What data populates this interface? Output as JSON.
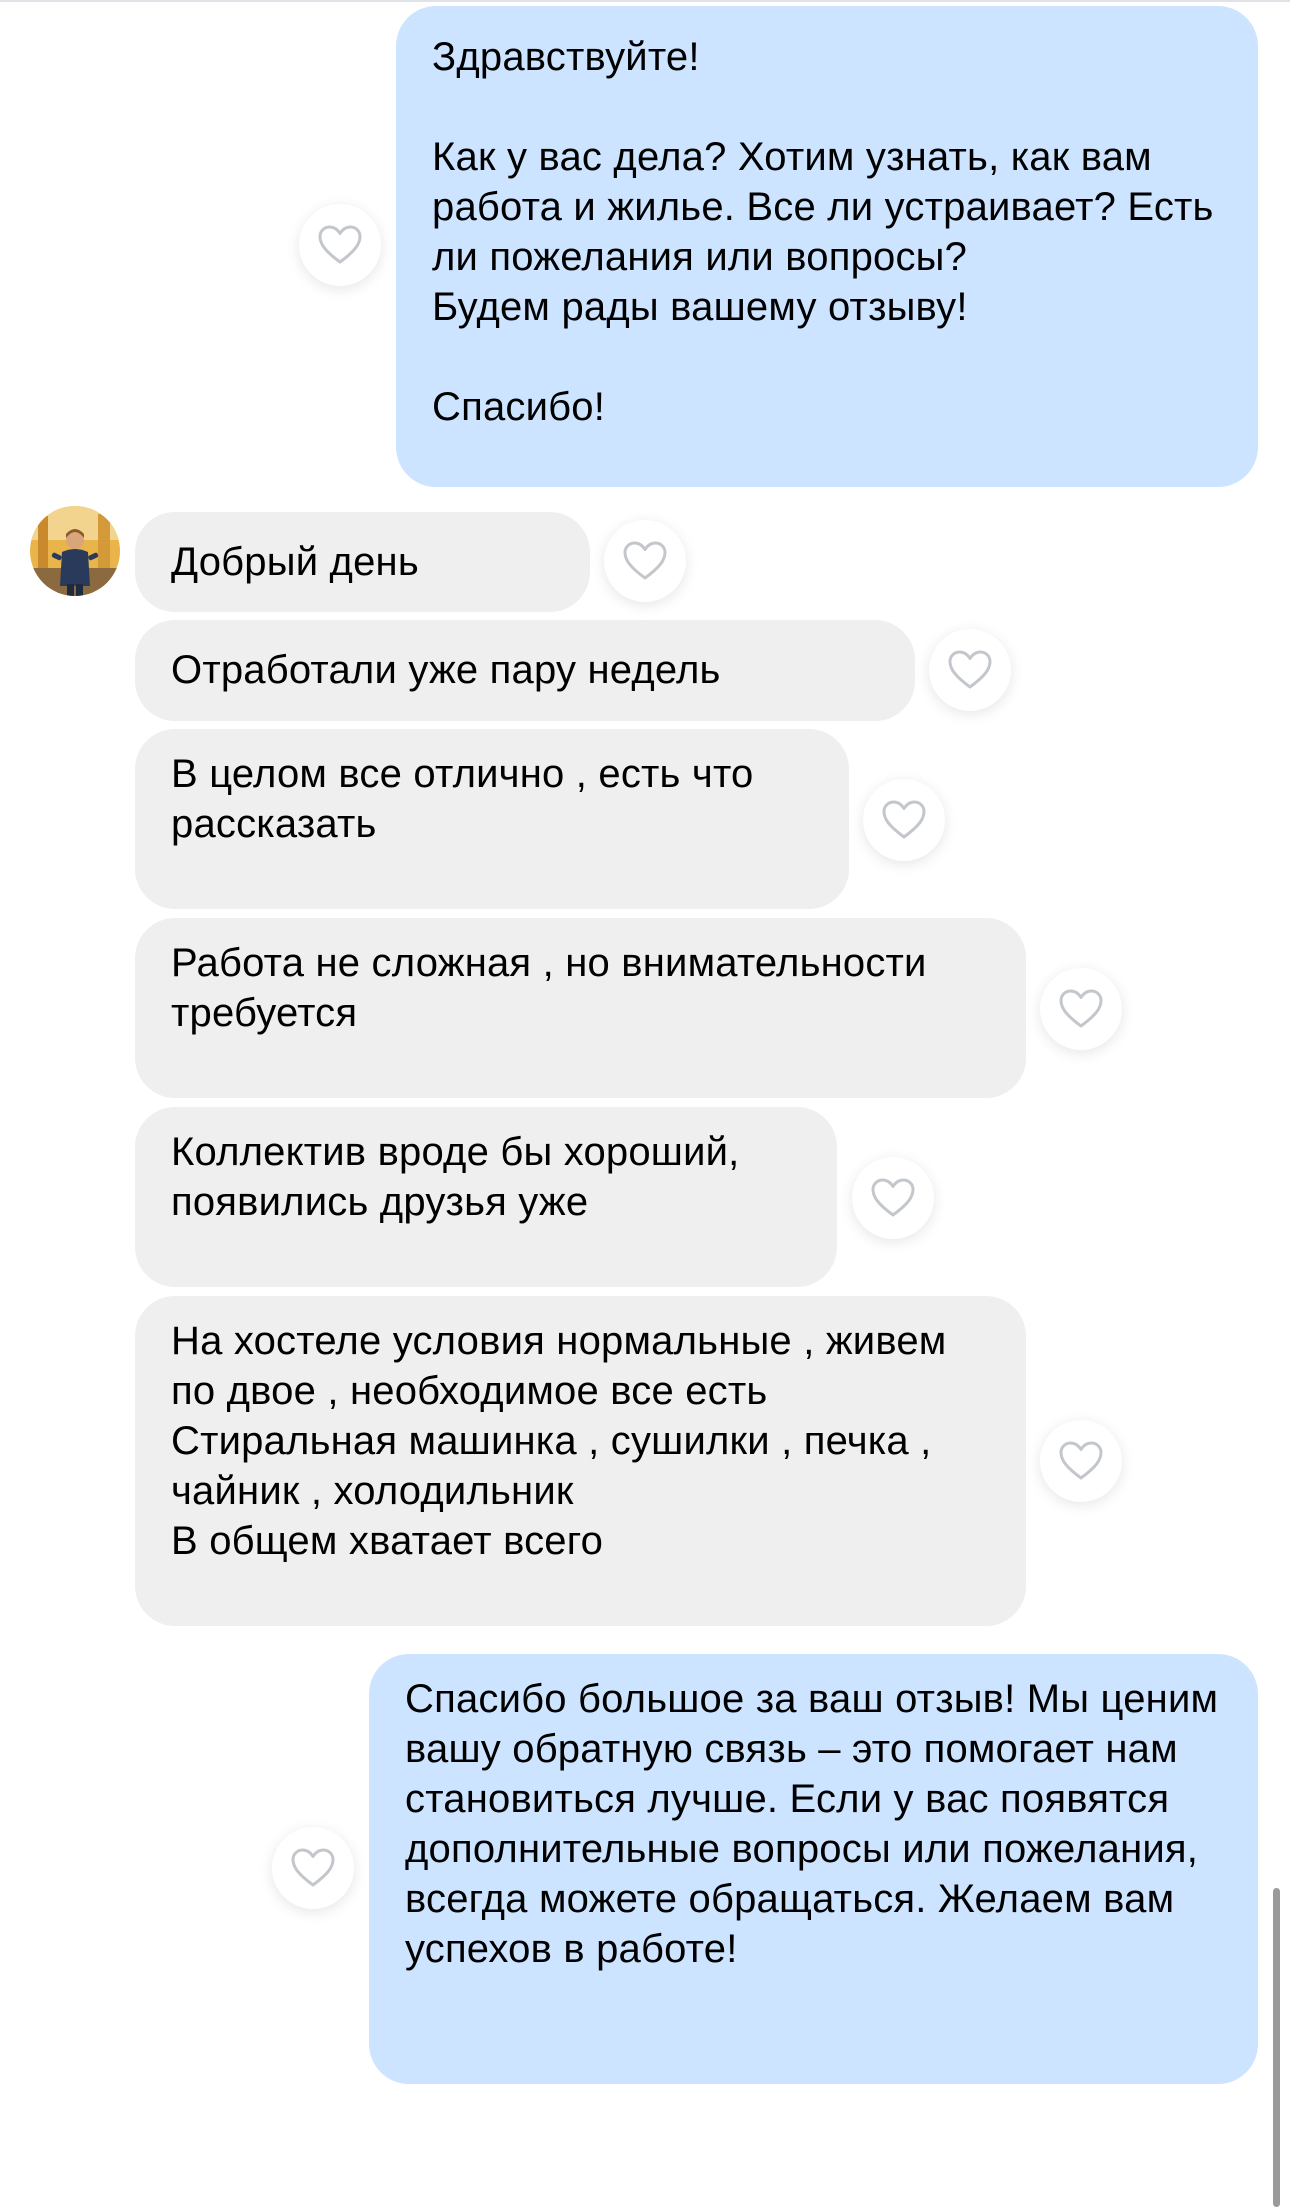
{
  "chat": {
    "messages": [
      {
        "direction": "outgoing",
        "text": "Здравствуйте!\n\nКак у вас дела? Хотим узнать, как вам работа и жилье. Все ли устраивает? Есть ли пожелания или вопросы?\nБудем рады вашему отзыву!\n\nСпасибо!"
      },
      {
        "direction": "incoming",
        "text": "Добрый день"
      },
      {
        "direction": "incoming",
        "text": "Отработали уже пару недель"
      },
      {
        "direction": "incoming",
        "text": "В целом все отлично , есть что рассказать"
      },
      {
        "direction": "incoming",
        "text": "Работа не сложная , но внимательности требуется"
      },
      {
        "direction": "incoming",
        "text": "Коллектив вроде бы хороший, появились друзья уже"
      },
      {
        "direction": "incoming",
        "text": "На хостеле условия нормальные , живем по двое , необходимое все есть\nСтиральная машинка , сушилки , печка , чайник , холодильник\nВ общем хватает всего"
      },
      {
        "direction": "outgoing",
        "text": "Спасибо большое за ваш отзыв! Мы ценим вашу обратную связь – это помогает нам становиться лучше. Если у вас появятся дополнительные вопросы или пожелания, всегда можете обращаться. Желаем вам успехов в работе!"
      }
    ],
    "like_icon": "heart-outline-icon",
    "colors": {
      "outgoing_bubble": "#cce4ff",
      "incoming_bubble": "#efefef",
      "like_icon_stroke": "#c3c7cc"
    }
  }
}
